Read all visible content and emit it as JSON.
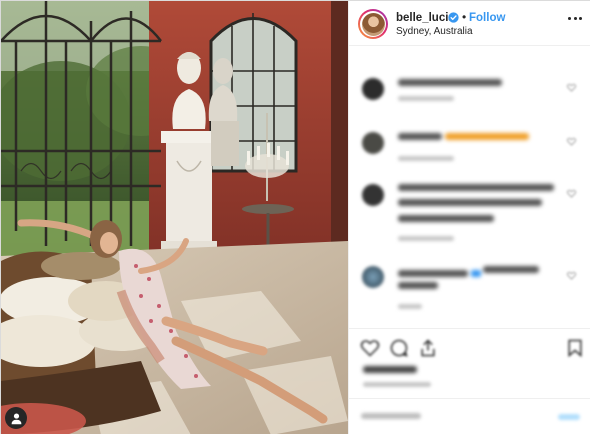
{
  "post": {
    "username": "belle_lucia",
    "separator": "•",
    "follow_label": "Follow",
    "location": "Sydney, Australia",
    "icons": {
      "verified": "verified-badge-icon",
      "more": "more-options-icon",
      "user_tag": "user-tag-icon",
      "like": "heart-icon",
      "comment": "comment-icon",
      "share": "share-icon",
      "save": "bookmark-icon"
    },
    "accent_color": "#3897f0",
    "photo_description_colors": {
      "wall": "#9a3d30",
      "sky": "#dfe7df",
      "floor": "#cbbda8"
    }
  },
  "comments": [
    {
      "text": "",
      "meta": ""
    },
    {
      "text": "",
      "meta": ""
    },
    {
      "text": "",
      "meta": ""
    },
    {
      "text": "",
      "meta": ""
    }
  ],
  "likes": "",
  "timestamp": "",
  "add_comment_placeholder": "",
  "post_label": ""
}
